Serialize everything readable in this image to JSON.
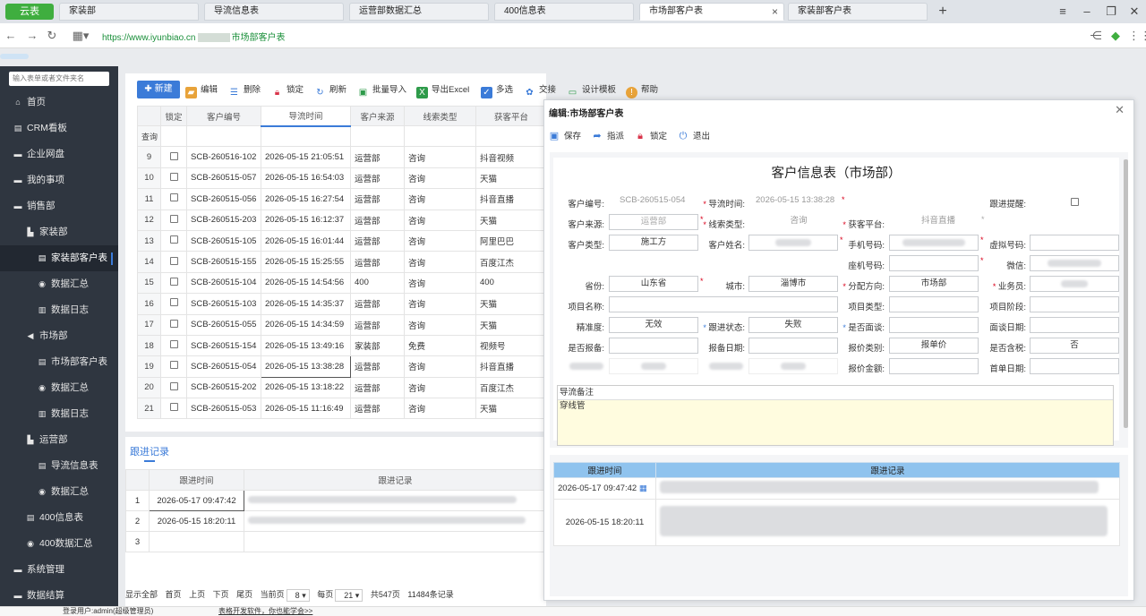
{
  "browser": {
    "brand": "云表",
    "tabs": [
      "家装部",
      "导流信息表",
      "运营部数据汇总",
      "400信息表",
      "市场部客户表",
      "家装部客户表"
    ],
    "active_tab": 4,
    "url_prefix": "https://www.iyunbiao.cn",
    "url_suffix": "市场部客户表"
  },
  "sidebar": {
    "search_placeholder": "输入表单或者文件夹名",
    "items": [
      {
        "label": "首页",
        "icon": "home-icon"
      },
      {
        "label": "CRM看板",
        "icon": "doc-icon"
      },
      {
        "label": "企业网盘",
        "icon": "folder-icon"
      },
      {
        "label": "我的事项",
        "icon": "folder-icon"
      },
      {
        "label": "销售部",
        "icon": "folder-icon"
      },
      {
        "label": "家装部",
        "icon": "org-icon"
      },
      {
        "label": "家装部客户表",
        "icon": "doc-icon"
      },
      {
        "label": "数据汇总",
        "icon": "eye-icon"
      },
      {
        "label": "数据日志",
        "icon": "log-icon"
      },
      {
        "label": "市场部",
        "icon": "send-icon"
      },
      {
        "label": "市场部客户表",
        "icon": "doc-icon"
      },
      {
        "label": "数据汇总",
        "icon": "eye-icon"
      },
      {
        "label": "数据日志",
        "icon": "log-icon"
      },
      {
        "label": "运营部",
        "icon": "org-icon"
      },
      {
        "label": "导流信息表",
        "icon": "doc-icon"
      },
      {
        "label": "数据汇总",
        "icon": "eye-icon"
      },
      {
        "label": "400信息表",
        "icon": "doc-icon"
      },
      {
        "label": "400数据汇总",
        "icon": "eye-icon"
      },
      {
        "label": "系统管理",
        "icon": "folder-icon"
      },
      {
        "label": "数据结算",
        "icon": "folder-icon"
      }
    ]
  },
  "toolbar": {
    "new": "新建",
    "edit": "编辑",
    "delete": "删除",
    "lock": "锁定",
    "refresh": "刷新",
    "import": "批量导入",
    "export": "导出Excel",
    "multi": "多选",
    "exchange": "交接",
    "template": "设计模板",
    "help": "帮助"
  },
  "grid": {
    "headers": [
      "锁定",
      "客户编号",
      "导流时间",
      "客户来源",
      "线索类型",
      "获客平台"
    ],
    "query_label": "查询",
    "rows": [
      {
        "no": "9",
        "id": "SCB-260516-102",
        "time": "2026-05-15 21:05:51",
        "source": "运营部",
        "type": "咨询",
        "platform": "抖音视频"
      },
      {
        "no": "10",
        "id": "SCB-260515-057",
        "time": "2026-05-15 16:54:03",
        "source": "运营部",
        "type": "咨询",
        "platform": "天猫"
      },
      {
        "no": "11",
        "id": "SCB-260515-056",
        "time": "2026-05-15 16:27:54",
        "source": "运营部",
        "type": "咨询",
        "platform": "抖音直播"
      },
      {
        "no": "12",
        "id": "SCB-260515-203",
        "time": "2026-05-15 16:12:37",
        "source": "运营部",
        "type": "咨询",
        "platform": "天猫"
      },
      {
        "no": "13",
        "id": "SCB-260515-105",
        "time": "2026-05-15 16:01:44",
        "source": "运营部",
        "type": "咨询",
        "platform": "阿里巴巴"
      },
      {
        "no": "14",
        "id": "SCB-260515-155",
        "time": "2026-05-15 15:25:55",
        "source": "运营部",
        "type": "咨询",
        "platform": "百度江杰"
      },
      {
        "no": "15",
        "id": "SCB-260515-104",
        "time": "2026-05-15 14:54:56",
        "source": "400",
        "type": "咨询",
        "platform": "400"
      },
      {
        "no": "16",
        "id": "SCB-260515-103",
        "time": "2026-05-15 14:35:37",
        "source": "运营部",
        "type": "咨询",
        "platform": "天猫"
      },
      {
        "no": "17",
        "id": "SCB-260515-055",
        "time": "2026-05-15 14:34:59",
        "source": "运营部",
        "type": "咨询",
        "platform": "天猫"
      },
      {
        "no": "18",
        "id": "SCB-260515-154",
        "time": "2026-05-15 13:49:16",
        "source": "家装部",
        "type": "免费",
        "platform": "视频号"
      },
      {
        "no": "19",
        "id": "SCB-260515-054",
        "time": "2026-05-15 13:38:28",
        "source": "运营部",
        "type": "咨询",
        "platform": "抖音直播"
      },
      {
        "no": "20",
        "id": "SCB-260515-202",
        "time": "2026-05-15 13:18:22",
        "source": "运营部",
        "type": "咨询",
        "platform": "百度江杰"
      },
      {
        "no": "21",
        "id": "SCB-260515-053",
        "time": "2026-05-15 11:16:49",
        "source": "运营部",
        "type": "咨询",
        "platform": "天猫"
      }
    ]
  },
  "records": {
    "title": "跟进记录",
    "headers": [
      "跟进时间",
      "跟进记录"
    ],
    "rows": [
      {
        "no": "1",
        "time": "2026-05-17 09:47:42"
      },
      {
        "no": "2",
        "time": "2026-05-15 18:20:11"
      },
      {
        "no": "3",
        "time": ""
      }
    ]
  },
  "pager": {
    "show_all": "显示全部",
    "first": "首页",
    "prev": "上页",
    "next": "下页",
    "last": "尾页",
    "current_label": "当前页",
    "current": "8",
    "per_label": "每页",
    "per": "21",
    "total_pages": "共547页",
    "total_records": "11484条记录"
  },
  "status": {
    "user": "登录用户:admin(超级管理员)",
    "link": "表格开发软件，你也能学会>>"
  },
  "dialog": {
    "title": "编辑:市场部客户表",
    "save": "保存",
    "assign": "指派",
    "lock": "锁定",
    "exit": "退出",
    "form_title": "客户信息表（市场部）",
    "labels": {
      "cust_no": "客户编号:",
      "flow_time": "导流时间:",
      "reminder": "跟进提醒:",
      "source": "客户来源:",
      "lead_type": "线索类型:",
      "platform": "获客平台:",
      "cust_type": "客户类型:",
      "cust_name": "客户姓名:",
      "phone": "手机号码:",
      "virtual": "虚拟号码:",
      "landline": "座机号码:",
      "wechat": "微信:",
      "province": "省份:",
      "city": "城市:",
      "direction": "分配方向:",
      "salesman": "业务员:",
      "project": "项目名称:",
      "project_type": "项目类型:",
      "project_stage": "项目阶段:",
      "accuracy": "精准度:",
      "status": "跟进状态:",
      "meeting": "是否面谈:",
      "meeting_date": "面谈日期:",
      "quote": "是否报备:",
      "quote_date": "报备日期:",
      "price_cat": "报价类别:",
      "tax": "是否含税:",
      "price_amount": "报价金额:",
      "first_date": "首单日期:"
    },
    "values": {
      "cust_no": "SCB-260515-054",
      "flow_time": "2026-05-15 13:38:28",
      "source": "运营部",
      "lead_type": "咨询",
      "platform": "抖音直播",
      "cust_type": "施工方",
      "province": "山东省",
      "city": "淄博市",
      "direction": "市场部",
      "accuracy": "无效",
      "status": "失败",
      "price_cat": "报单价",
      "tax": "否"
    },
    "notes_label": "导流备注",
    "notes_value": "穿线管",
    "rec_headers": [
      "跟进时间",
      "跟进记录"
    ],
    "rec_rows": [
      "2026-05-17 09:47:42",
      "2026-05-15 18:20:11"
    ]
  }
}
